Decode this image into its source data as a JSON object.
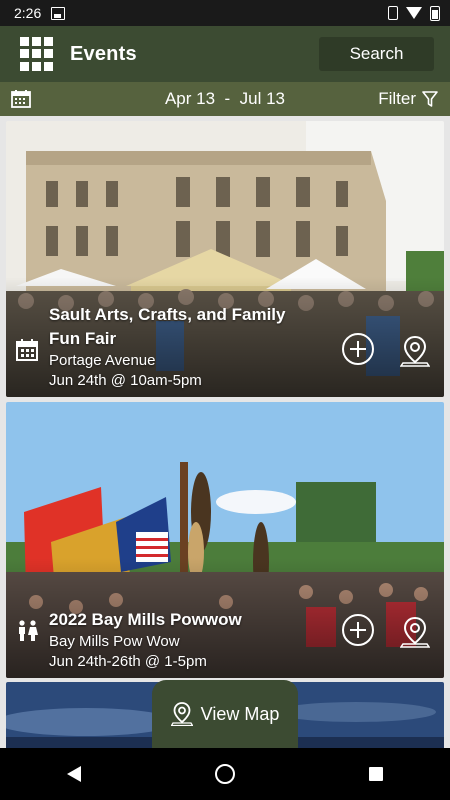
{
  "status_bar": {
    "time": "2:26"
  },
  "app_bar": {
    "title": "Events",
    "search_label": "Search",
    "menu_icon": "grid-icon"
  },
  "date_bar": {
    "start": "Apr 13",
    "separator": "-",
    "end": "Jul 13",
    "filter_label": "Filter"
  },
  "events": [
    {
      "title": "Sault Arts, Crafts, and Family Fun Fair",
      "venue": "Portage Avenue",
      "time": "Jun 24th @ 10am-5pm",
      "type_icon": "calendar-icon"
    },
    {
      "title": "2022 Bay Mills Powwow",
      "venue": "Bay Mills Pow Wow",
      "time": "Jun 24th-26th @ 1-5pm",
      "type_icon": "family-icon"
    }
  ],
  "view_map_label": "View Map",
  "colors": {
    "app_bar": "#3c4b32",
    "date_bar": "#56623e"
  }
}
